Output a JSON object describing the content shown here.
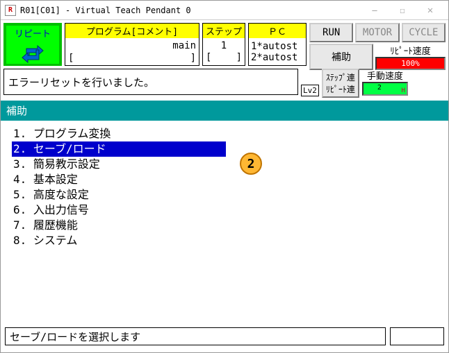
{
  "window": {
    "title": "R01[C01] - Virtual Teach Pendant 0"
  },
  "repeat": {
    "label": "リピート"
  },
  "program": {
    "header": "プログラム[コメント]",
    "name": "main",
    "bracket_l": "[",
    "bracket_r": "]"
  },
  "step": {
    "header": "ステップ",
    "value": "1",
    "bracket_l": "[",
    "bracket_r": "]"
  },
  "pc": {
    "header": "ＰＣ",
    "line1": "1*autost",
    "line2": "2*autost"
  },
  "buttons": {
    "run": "RUN",
    "motor": "MOTOR",
    "cycle": "CYCLE",
    "assist": "補助"
  },
  "repeat_speed": {
    "label": "ﾘﾋﾟｰﾄ速度",
    "value": "100%"
  },
  "manual_speed": {
    "label": "手動速度",
    "value": "2"
  },
  "message": "エラーリセットを行いました。",
  "level": "Lv2",
  "step_link": {
    "l1": "ｽﾃｯﾌﾟ連",
    "l2": "ﾘﾋﾟｰﾄ連"
  },
  "section": "補助",
  "menu": [
    "1. プログラム変換",
    "2. セーブ/ロード",
    "3. 簡易教示設定",
    "4. 基本設定",
    "5. 高度な設定",
    "6. 入出力信号",
    "7. 履歴機能",
    "8. システム"
  ],
  "selected_index": 1,
  "annotation": "2",
  "footer": "セーブ/ロードを選択します"
}
